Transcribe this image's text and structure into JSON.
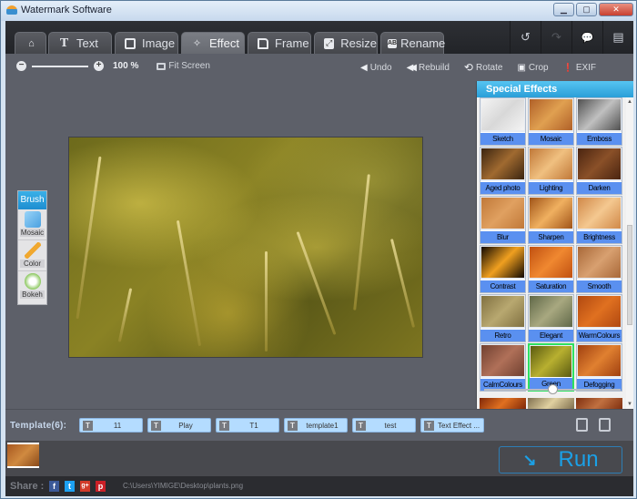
{
  "window": {
    "title": "Watermark Software",
    "controls": {
      "minimize": "▁",
      "maximize": "▢",
      "close": "✕"
    }
  },
  "tabs": [
    {
      "icon": "home-icon",
      "label": ""
    },
    {
      "icon": "text-icon",
      "label": "Text"
    },
    {
      "icon": "image-icon",
      "label": "Image"
    },
    {
      "icon": "magic-wand-icon",
      "label": "Effect",
      "active": true
    },
    {
      "icon": "frame-icon",
      "label": "Frame"
    },
    {
      "icon": "resize-icon",
      "label": "Resize"
    },
    {
      "icon": "rename-icon",
      "label": "Rename"
    }
  ],
  "top_tools": [
    {
      "icon": "undo-icon",
      "glyph": "↺"
    },
    {
      "icon": "redo-icon",
      "glyph": "↷"
    },
    {
      "icon": "feedback-icon",
      "glyph": "💬"
    },
    {
      "icon": "register-icon",
      "glyph": "▤"
    }
  ],
  "zoom": {
    "value": "100 %",
    "fit_label": "Fit Screen"
  },
  "actions": [
    {
      "icon": "undo-arrow-icon",
      "glyph": "◀",
      "label": "Undo"
    },
    {
      "icon": "rebuild-icon",
      "glyph": "◀◀",
      "label": "Rebuild"
    },
    {
      "icon": "rotate-icon",
      "glyph": "⟲",
      "label": "Rotate"
    },
    {
      "icon": "crop-icon",
      "glyph": "▣",
      "label": "Crop"
    },
    {
      "icon": "exif-icon",
      "glyph": "❗",
      "label": "EXIF"
    }
  ],
  "brush": {
    "title": "Brush",
    "items": [
      {
        "label": "Mosaic",
        "color": "#6cb8ec"
      },
      {
        "label": "Color",
        "color": "#f0a830"
      },
      {
        "label": "Bokeh",
        "color": "#8cc860"
      }
    ]
  },
  "effects_panel": {
    "title": "Special Effects",
    "slider_value": 0.5,
    "effects": [
      {
        "label": "Sketch",
        "colors": [
          "#f4f4f4",
          "#d8d8d8"
        ]
      },
      {
        "label": "Mosaic",
        "colors": [
          "#b06028",
          "#e0a050"
        ]
      },
      {
        "label": "Emboss",
        "colors": [
          "#505050",
          "#c0c0c0"
        ]
      },
      {
        "label": "Aged photo",
        "colors": [
          "#3a2410",
          "#a06a30"
        ]
      },
      {
        "label": "Lighting",
        "colors": [
          "#c07838",
          "#f0c080"
        ]
      },
      {
        "label": "Darken",
        "colors": [
          "#4a2410",
          "#8a5028"
        ]
      },
      {
        "label": "Blur",
        "colors": [
          "#c07838",
          "#e0a060"
        ]
      },
      {
        "label": "Sharpen",
        "colors": [
          "#a05418",
          "#f0b060"
        ]
      },
      {
        "label": "Brightness",
        "colors": [
          "#d08848",
          "#f4c890"
        ]
      },
      {
        "label": "Contrast",
        "colors": [
          "#100800",
          "#f0a020"
        ]
      },
      {
        "label": "Saturation",
        "colors": [
          "#c05010",
          "#f08830"
        ]
      },
      {
        "label": "Smooth",
        "colors": [
          "#a86838",
          "#d8a070"
        ]
      },
      {
        "label": "Retro",
        "colors": [
          "#807040",
          "#b8a870"
        ]
      },
      {
        "label": "Elegant",
        "colors": [
          "#606848",
          "#a8a880"
        ]
      },
      {
        "label": "WarmColours",
        "colors": [
          "#b04810",
          "#e07020"
        ]
      },
      {
        "label": "CalmColours",
        "colors": [
          "#704030",
          "#b07058"
        ]
      },
      {
        "label": "Green",
        "colors": [
          "#5a5a10",
          "#b8b030"
        ],
        "selected": true
      },
      {
        "label": "Defogging",
        "colors": [
          "#a04010",
          "#e08030"
        ]
      }
    ],
    "partial_row_colors": [
      [
        "#802808",
        "#e07020"
      ],
      [
        "#807050",
        "#e0d0a0"
      ],
      [
        "#803010",
        "#c07040"
      ]
    ]
  },
  "templates": {
    "label": "Template(6):",
    "items": [
      "11",
      "Play",
      "T1",
      "template1",
      "test",
      "Text Effect ..."
    ]
  },
  "run_button": {
    "label": "Run"
  },
  "status": {
    "share_label": "Share :",
    "share_icons": [
      {
        "name": "facebook-icon",
        "glyph": "f",
        "color": "#3b5998"
      },
      {
        "name": "twitter-icon",
        "glyph": "t",
        "color": "#1da1f2"
      },
      {
        "name": "google-plus-icon",
        "glyph": "g+",
        "color": "#d23b2a"
      },
      {
        "name": "pinterest-icon",
        "glyph": "p",
        "color": "#cb2027"
      }
    ],
    "file_path": "C:\\Users\\YIMIGE\\Desktop\\plants.png"
  }
}
